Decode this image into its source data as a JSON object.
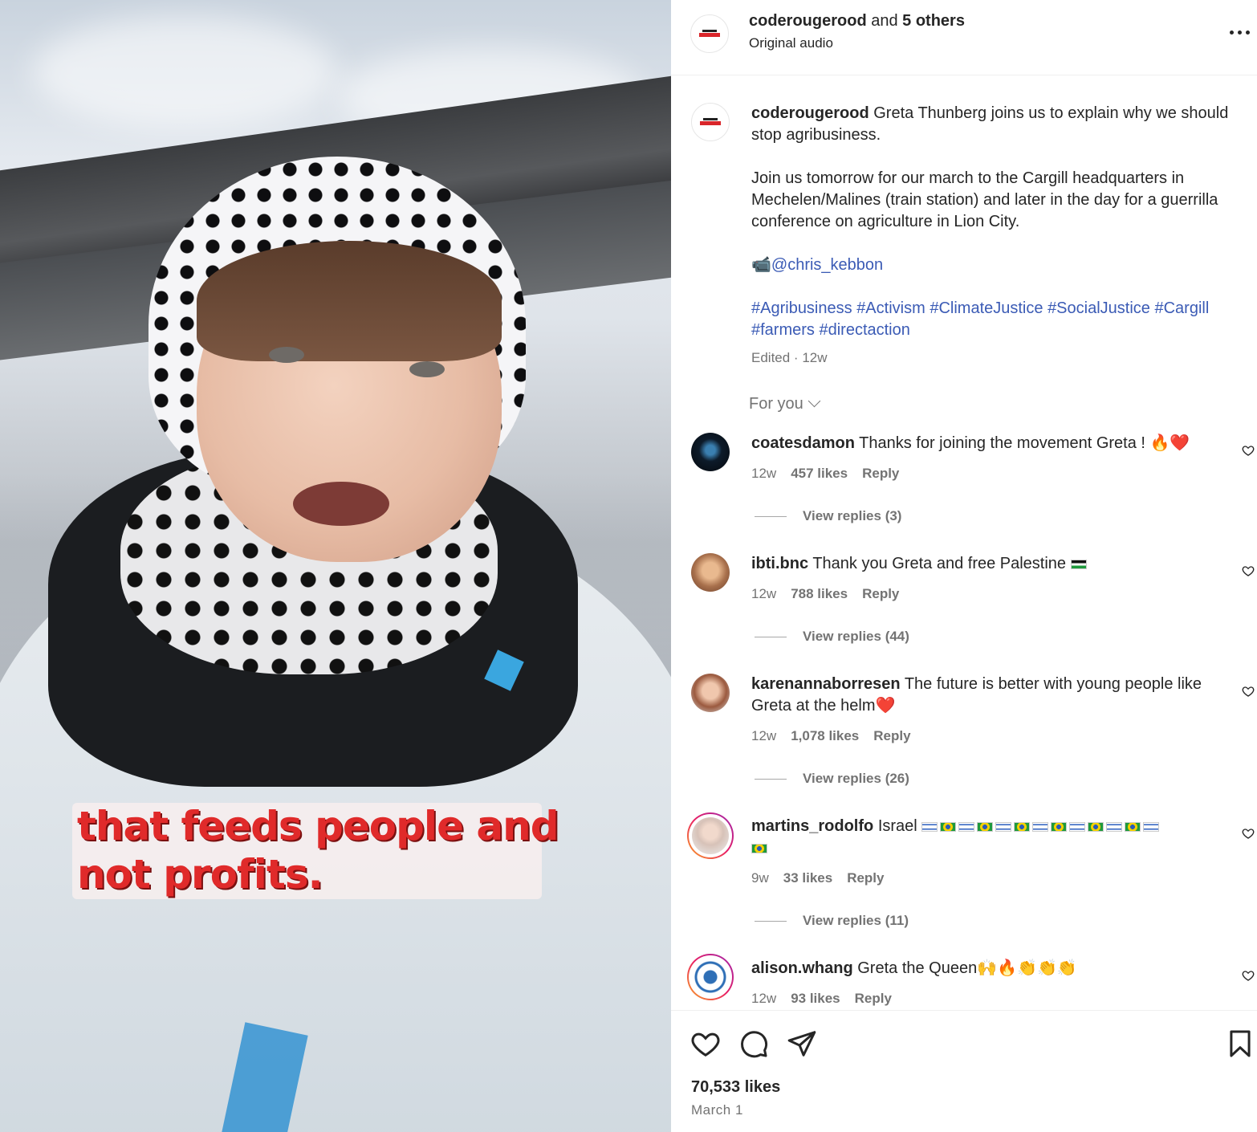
{
  "video": {
    "caption_line1": "that feeds people and",
    "caption_line2": "not profits."
  },
  "header": {
    "username": "coderougerood",
    "and_text": " and ",
    "others": "5 others",
    "audio": "Original audio",
    "more_icon": "more-horizontal-icon"
  },
  "post": {
    "username": "coderougerood",
    "text1": "Greta Thunberg joins us to explain why we should stop agribusiness.",
    "text2": "Join us tomorrow for our march to the Cargill headquarters in Mechelen/Malines (train station) and later in the day for a guerrilla conference on agriculture in Lion City.",
    "camera_emoji": "📹",
    "mention": "@chris_kebbon",
    "hashtags": [
      "#Agribusiness",
      "#Activism",
      "#ClimateJustice",
      "#SocialJustice",
      "#Cargill",
      "#farmers",
      "#directaction"
    ],
    "edited": "Edited",
    "separator": " · ",
    "age": "12w"
  },
  "comments_filter": {
    "label": "For you"
  },
  "comments": [
    {
      "username": "coatesdamon",
      "text": "Thanks for joining the movement Greta ! 🔥❤️",
      "age": "12w",
      "likes": "457 likes",
      "reply": "Reply",
      "view_replies": "View replies (3)"
    },
    {
      "username": "ibti.bnc",
      "text": "Thank you Greta and free Palestine",
      "age": "12w",
      "likes": "788 likes",
      "reply": "Reply",
      "view_replies": "View replies (44)"
    },
    {
      "username": "karenannaborresen",
      "text": "The future is better with young people like Greta at the helm❤️",
      "age": "12w",
      "likes": "1,078 likes",
      "reply": "Reply",
      "view_replies": "View replies (26)"
    },
    {
      "username": "martins_rodolfo",
      "text": "Israel",
      "age": "9w",
      "likes": "33 likes",
      "reply": "Reply",
      "view_replies": "View replies (11)"
    },
    {
      "username": "alison.whang",
      "text": "Greta the Queen🙌🔥👏👏👏",
      "age": "12w",
      "likes": "93 likes",
      "reply": "Reply"
    }
  ],
  "footer": {
    "likes": "70,533 likes",
    "date": "March 1"
  },
  "colors": {
    "link": "#3b5bb5",
    "muted": "#737373",
    "text": "#262626",
    "caption_red": "#e02a2a"
  }
}
